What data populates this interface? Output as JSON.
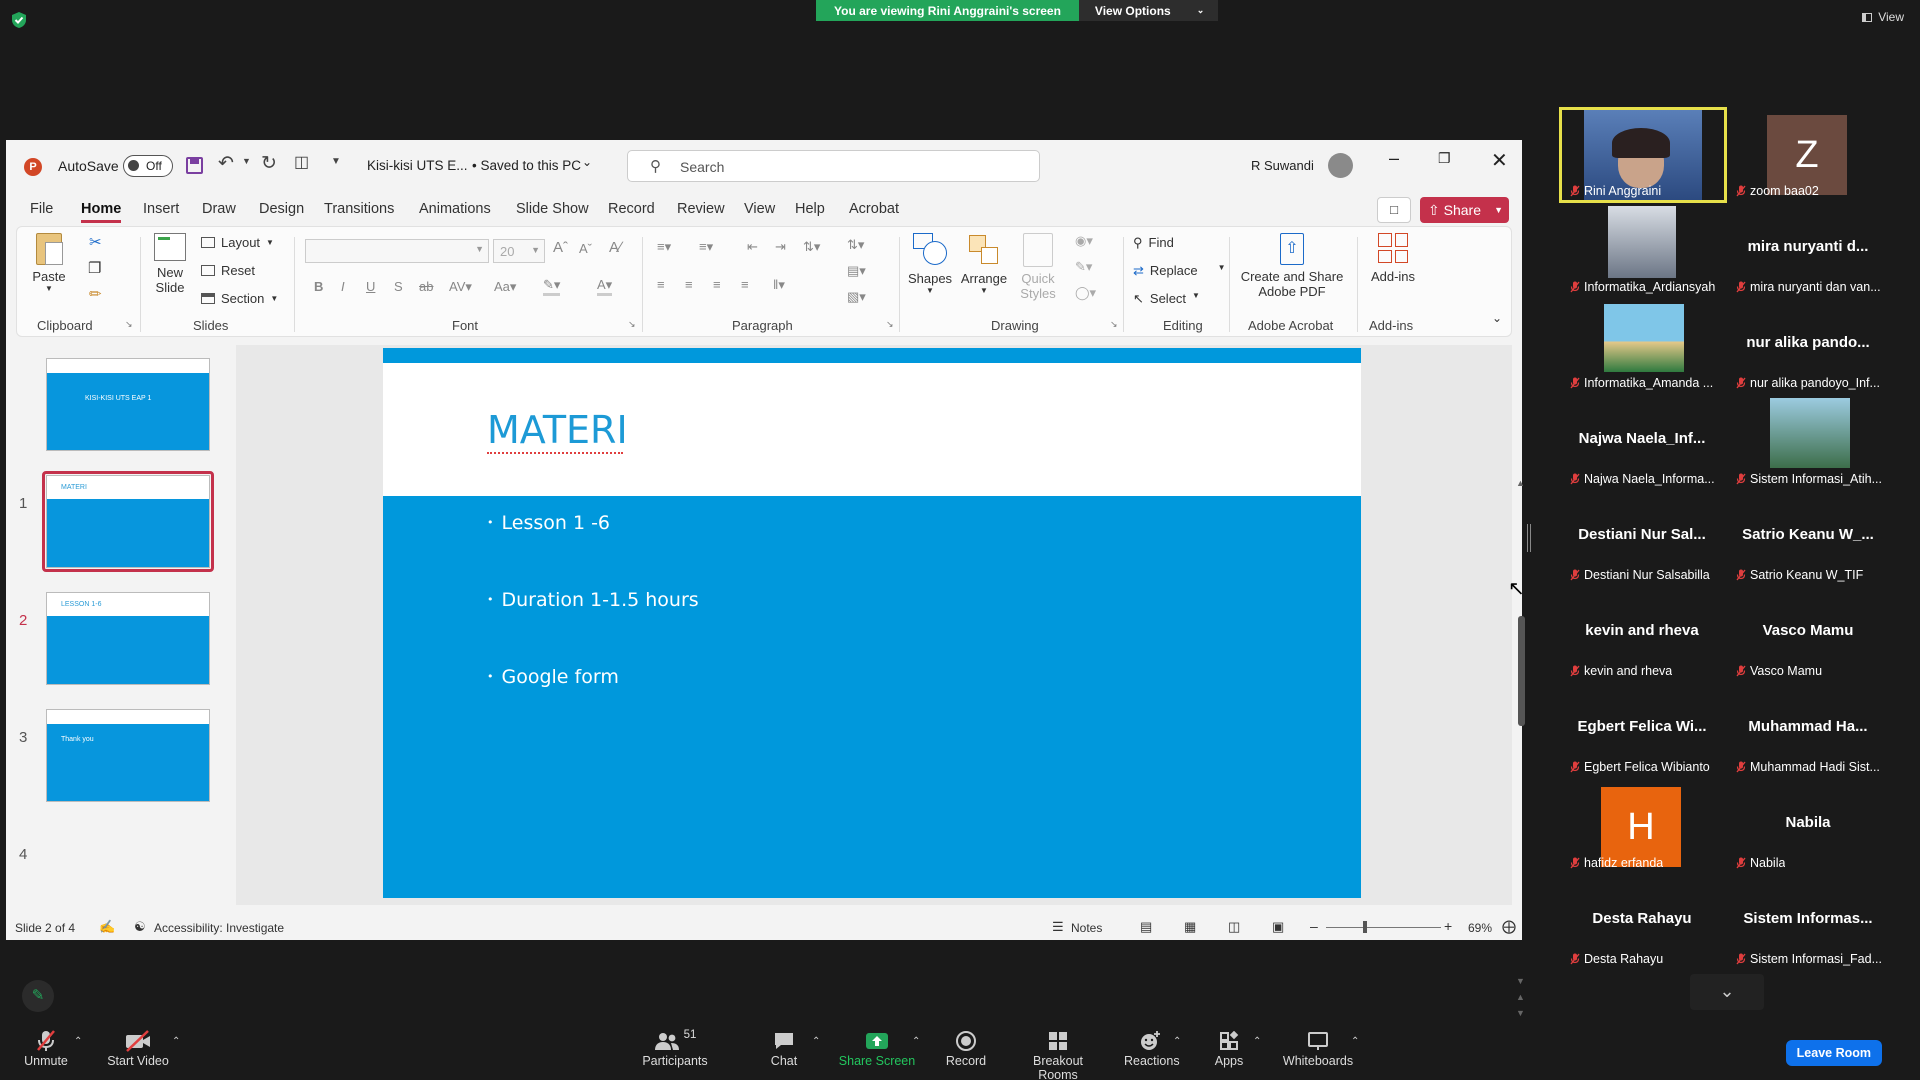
{
  "zoom": {
    "banner_text": "You are viewing Rini Anggraini's screen",
    "view_options": "View Options",
    "view_label": "View",
    "participants_count": "51",
    "toolbar": {
      "unmute": "Unmute",
      "start_video": "Start Video",
      "participants": "Participants",
      "chat": "Chat",
      "share_screen": "Share Screen",
      "record": "Record",
      "breakout": "Breakout Rooms",
      "reactions": "Reactions",
      "apps": "Apps",
      "whiteboards": "Whiteboards",
      "leave": "Leave Room"
    },
    "gallery": [
      {
        "name": "Rini Anggraini",
        "type": "video",
        "active": true
      },
      {
        "name": "zoom baa02",
        "type": "letter",
        "letter": "Z",
        "color": "#6b4a3f"
      },
      {
        "name": "Informatika_Ardiansyah",
        "type": "photo"
      },
      {
        "name": "mira nuryanti dan van...",
        "big": "mira nuryanti d...",
        "type": "text"
      },
      {
        "name": "Informatika_Amanda ...",
        "type": "photo2"
      },
      {
        "name": "nur alika pandoyo_Inf...",
        "big": "nur alika pando...",
        "type": "text"
      },
      {
        "name": "Najwa Naela_Informa...",
        "big": "Najwa  Naela_Inf...",
        "type": "text"
      },
      {
        "name": "Sistem Informasi_Atih...",
        "type": "photo3"
      },
      {
        "name": "Destiani Nur Salsabilla",
        "big": "Destiani  Nur Sal...",
        "type": "text"
      },
      {
        "name": "Satrio Keanu W_TIF",
        "big": "Satrio Keanu W_...",
        "type": "text"
      },
      {
        "name": "kevin and rheva",
        "big": "kevin and rheva",
        "type": "text"
      },
      {
        "name": "Vasco Mamu",
        "big": "Vasco Mamu",
        "type": "text"
      },
      {
        "name": "Egbert Felica Wibianto",
        "big": "Egbert Felica Wi...",
        "type": "text"
      },
      {
        "name": "Muhammad Hadi Sist...",
        "big": "Muhammad  Ha...",
        "type": "text"
      },
      {
        "name": "hafidz erfanda",
        "type": "letter",
        "letter": "H",
        "color": "#e8640e"
      },
      {
        "name": "Nabila",
        "big": "Nabila",
        "type": "text"
      },
      {
        "name": "Desta Rahayu",
        "big": "Desta Rahayu",
        "type": "text"
      },
      {
        "name": "Sistem Informasi_Fad...",
        "big": "Sistem  Informas...",
        "type": "text"
      }
    ]
  },
  "ppt": {
    "autosave": "AutoSave",
    "autosave_state": "Off",
    "filename": "Kisi-kisi UTS E...",
    "saved": "• Saved to this PC",
    "search_placeholder": "Search",
    "user": "R Suwandi",
    "menu": [
      "File",
      "Home",
      "Insert",
      "Draw",
      "Design",
      "Transitions",
      "Animations",
      "Slide Show",
      "Record",
      "Review",
      "View",
      "Help",
      "Acrobat"
    ],
    "share": "Share",
    "ribbon": {
      "paste": "Paste",
      "clipboard": "Clipboard",
      "new_slide": "New",
      "new_slide2": "Slide",
      "layout": "Layout",
      "reset": "Reset",
      "section": "Section",
      "slides": "Slides",
      "font": "Font",
      "font_size": "20",
      "paragraph": "Paragraph",
      "shapes": "Shapes",
      "arrange": "Arrange",
      "quick": "Quick",
      "styles": "Styles",
      "drawing": "Drawing",
      "find": "Find",
      "replace": "Replace",
      "select": "Select",
      "editing": "Editing",
      "create_share": "Create and Share",
      "adobe_pdf": "Adobe PDF",
      "adobe_acrobat": "Adobe Acrobat",
      "addins": "Add-ins",
      "addins_group": "Add-ins"
    },
    "thumbs": [
      {
        "num": "1",
        "title": "KISI-KISI UTS EAP 1"
      },
      {
        "num": "2",
        "title": "MATERI"
      },
      {
        "num": "3",
        "title": "LESSON 1-6"
      },
      {
        "num": "4",
        "title": "Thank you"
      }
    ],
    "slide": {
      "title": "MATERI",
      "bullets": [
        "Lesson 1 -6",
        "Duration 1-1.5 hours",
        "Google form"
      ]
    },
    "status": {
      "slide_of": "Slide 2 of 4",
      "accessibility": "Accessibility: Investigate",
      "notes": "Notes",
      "zoom": "69%"
    }
  }
}
